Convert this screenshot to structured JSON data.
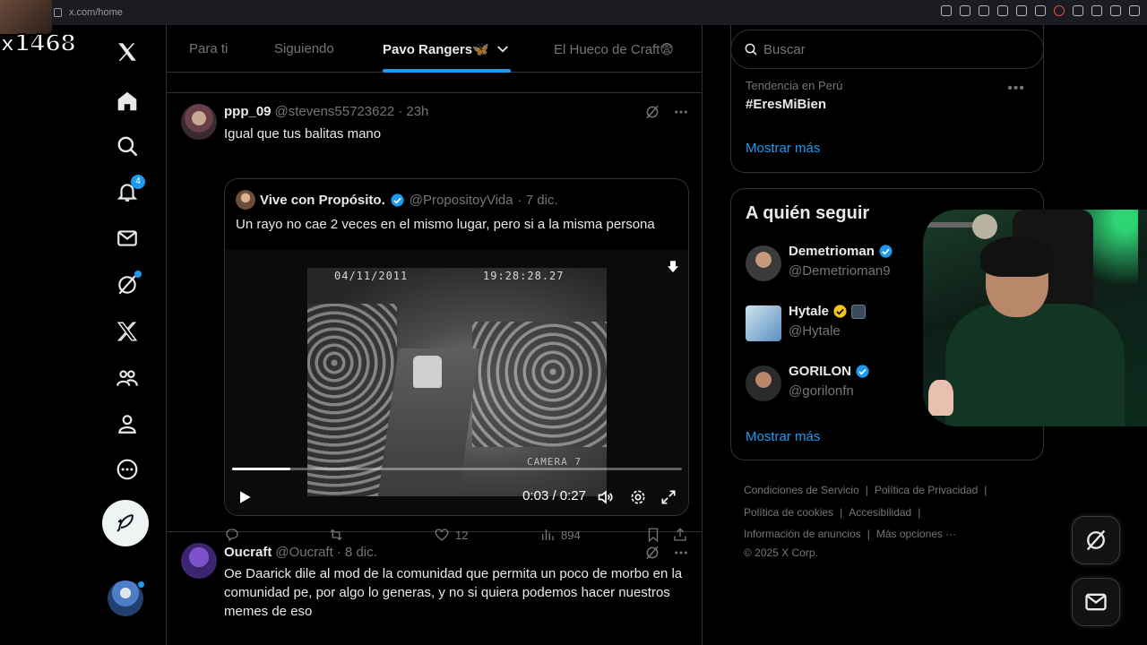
{
  "browser": {
    "url": "x.com/home"
  },
  "overlay": {
    "sub_count": "x1468"
  },
  "nav": {
    "notifications_badge": "4"
  },
  "tabs": [
    {
      "label": "Para ti"
    },
    {
      "label": "Siguiendo"
    },
    {
      "label": "Pavo Rangers🦋"
    },
    {
      "label": "El Hueco de Craft😨"
    }
  ],
  "post1": {
    "name": "ppp_09",
    "handle": "@stevens55723622",
    "time": "· 23h",
    "text": "Igual que tus balitas mano",
    "quote": {
      "name": "Vive con Propósito.",
      "handle": "@PropositoyVida",
      "time": "· 7 dic.",
      "text": "Un rayo no cae 2 veces en el mismo lugar, pero si a la misma persona",
      "video": {
        "timestamp_date": "04/11/2011",
        "timestamp_time": "19:28:28.27",
        "camera_label": "CAMERA 7",
        "time": "0:03 / 0:27",
        "progress": 0.13
      }
    },
    "stats": {
      "replies": "",
      "reposts": "",
      "likes": "12",
      "views": "894"
    }
  },
  "post2": {
    "name": "Oucraft",
    "handle": "@Oucraft",
    "time": "· 8 dic.",
    "text": "Oe Daarick dile al mod de la comunidad que permita un poco de morbo en la comunidad pe, por algo lo generas, y no si quiera podemos hacer nuestros memes de eso"
  },
  "search": {
    "placeholder": "Buscar"
  },
  "trends": {
    "category": "Tendencia en Perú",
    "tag": "#EresMiBien",
    "show_more": "Mostrar más"
  },
  "who_to_follow": {
    "title": "A quién seguir",
    "accounts": [
      {
        "name": "Demetrioman",
        "handle": "@Demetrioman9"
      },
      {
        "name": "Hytale",
        "handle": "@Hytale"
      },
      {
        "name": "GORILON",
        "handle": "@gorilonfn"
      }
    ],
    "show_more": "Mostrar más"
  },
  "footer": {
    "terms": "Condiciones de Servicio",
    "privacy": "Política de Privacidad",
    "cookies": "Política de cookies",
    "accessibility": "Accesibilidad",
    "ads": "Información de anuncios",
    "more": "Más opciones ···",
    "copyright": "© 2025 X Corp."
  },
  "colors": {
    "accent": "#1d9bf0",
    "background": "#000000",
    "border": "#2f3336",
    "muted": "#71767b",
    "gold_badge": "#f5c518"
  }
}
